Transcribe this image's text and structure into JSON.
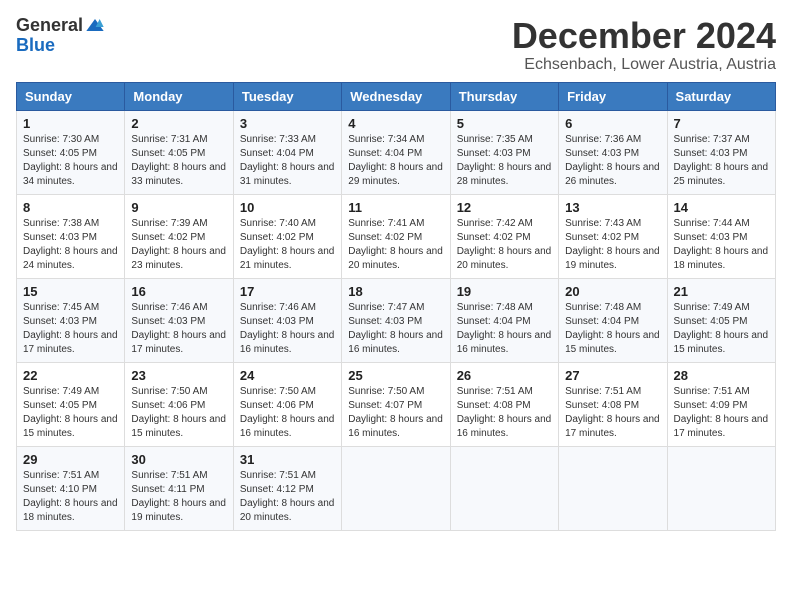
{
  "logo": {
    "general": "General",
    "blue": "Blue"
  },
  "header": {
    "month": "December 2024",
    "location": "Echsenbach, Lower Austria, Austria"
  },
  "weekdays": [
    "Sunday",
    "Monday",
    "Tuesday",
    "Wednesday",
    "Thursday",
    "Friday",
    "Saturday"
  ],
  "weeks": [
    [
      {
        "day": "1",
        "sunrise": "7:30 AM",
        "sunset": "4:05 PM",
        "daylight": "8 hours and 34 minutes."
      },
      {
        "day": "2",
        "sunrise": "7:31 AM",
        "sunset": "4:05 PM",
        "daylight": "8 hours and 33 minutes."
      },
      {
        "day": "3",
        "sunrise": "7:33 AM",
        "sunset": "4:04 PM",
        "daylight": "8 hours and 31 minutes."
      },
      {
        "day": "4",
        "sunrise": "7:34 AM",
        "sunset": "4:04 PM",
        "daylight": "8 hours and 29 minutes."
      },
      {
        "day": "5",
        "sunrise": "7:35 AM",
        "sunset": "4:03 PM",
        "daylight": "8 hours and 28 minutes."
      },
      {
        "day": "6",
        "sunrise": "7:36 AM",
        "sunset": "4:03 PM",
        "daylight": "8 hours and 26 minutes."
      },
      {
        "day": "7",
        "sunrise": "7:37 AM",
        "sunset": "4:03 PM",
        "daylight": "8 hours and 25 minutes."
      }
    ],
    [
      {
        "day": "8",
        "sunrise": "7:38 AM",
        "sunset": "4:03 PM",
        "daylight": "8 hours and 24 minutes."
      },
      {
        "day": "9",
        "sunrise": "7:39 AM",
        "sunset": "4:02 PM",
        "daylight": "8 hours and 23 minutes."
      },
      {
        "day": "10",
        "sunrise": "7:40 AM",
        "sunset": "4:02 PM",
        "daylight": "8 hours and 21 minutes."
      },
      {
        "day": "11",
        "sunrise": "7:41 AM",
        "sunset": "4:02 PM",
        "daylight": "8 hours and 20 minutes."
      },
      {
        "day": "12",
        "sunrise": "7:42 AM",
        "sunset": "4:02 PM",
        "daylight": "8 hours and 20 minutes."
      },
      {
        "day": "13",
        "sunrise": "7:43 AM",
        "sunset": "4:02 PM",
        "daylight": "8 hours and 19 minutes."
      },
      {
        "day": "14",
        "sunrise": "7:44 AM",
        "sunset": "4:03 PM",
        "daylight": "8 hours and 18 minutes."
      }
    ],
    [
      {
        "day": "15",
        "sunrise": "7:45 AM",
        "sunset": "4:03 PM",
        "daylight": "8 hours and 17 minutes."
      },
      {
        "day": "16",
        "sunrise": "7:46 AM",
        "sunset": "4:03 PM",
        "daylight": "8 hours and 17 minutes."
      },
      {
        "day": "17",
        "sunrise": "7:46 AM",
        "sunset": "4:03 PM",
        "daylight": "8 hours and 16 minutes."
      },
      {
        "day": "18",
        "sunrise": "7:47 AM",
        "sunset": "4:03 PM",
        "daylight": "8 hours and 16 minutes."
      },
      {
        "day": "19",
        "sunrise": "7:48 AM",
        "sunset": "4:04 PM",
        "daylight": "8 hours and 16 minutes."
      },
      {
        "day": "20",
        "sunrise": "7:48 AM",
        "sunset": "4:04 PM",
        "daylight": "8 hours and 15 minutes."
      },
      {
        "day": "21",
        "sunrise": "7:49 AM",
        "sunset": "4:05 PM",
        "daylight": "8 hours and 15 minutes."
      }
    ],
    [
      {
        "day": "22",
        "sunrise": "7:49 AM",
        "sunset": "4:05 PM",
        "daylight": "8 hours and 15 minutes."
      },
      {
        "day": "23",
        "sunrise": "7:50 AM",
        "sunset": "4:06 PM",
        "daylight": "8 hours and 15 minutes."
      },
      {
        "day": "24",
        "sunrise": "7:50 AM",
        "sunset": "4:06 PM",
        "daylight": "8 hours and 16 minutes."
      },
      {
        "day": "25",
        "sunrise": "7:50 AM",
        "sunset": "4:07 PM",
        "daylight": "8 hours and 16 minutes."
      },
      {
        "day": "26",
        "sunrise": "7:51 AM",
        "sunset": "4:08 PM",
        "daylight": "8 hours and 16 minutes."
      },
      {
        "day": "27",
        "sunrise": "7:51 AM",
        "sunset": "4:08 PM",
        "daylight": "8 hours and 17 minutes."
      },
      {
        "day": "28",
        "sunrise": "7:51 AM",
        "sunset": "4:09 PM",
        "daylight": "8 hours and 17 minutes."
      }
    ],
    [
      {
        "day": "29",
        "sunrise": "7:51 AM",
        "sunset": "4:10 PM",
        "daylight": "8 hours and 18 minutes."
      },
      {
        "day": "30",
        "sunrise": "7:51 AM",
        "sunset": "4:11 PM",
        "daylight": "8 hours and 19 minutes."
      },
      {
        "day": "31",
        "sunrise": "7:51 AM",
        "sunset": "4:12 PM",
        "daylight": "8 hours and 20 minutes."
      },
      null,
      null,
      null,
      null
    ]
  ],
  "labels": {
    "sunrise": "Sunrise:",
    "sunset": "Sunset:",
    "daylight": "Daylight:"
  }
}
